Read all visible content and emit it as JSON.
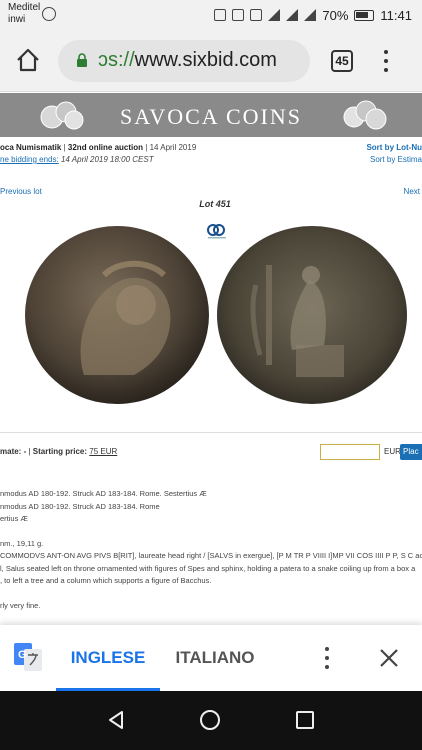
{
  "status_bar": {
    "carrier": "Meditel inwi",
    "battery": "70%",
    "time": "11:41"
  },
  "browser": {
    "url_prefix": "ɔs://",
    "url_domain": "www.sixbid.com",
    "tab_count": "45"
  },
  "site": {
    "title": "SAVOCA COINS"
  },
  "auction": {
    "house": "oca Numismatik",
    "sep1": "|",
    "auction_name": "32nd online auction",
    "sep2": "|",
    "date": "14 April 2019",
    "bidding_label": "ne bidding ends:",
    "bidding_end": "14 April 2019 18:00 CEST",
    "sort_lot": "Sort by Lot-Nu",
    "sort_estimate": "Sort by Estima"
  },
  "lot_nav": {
    "previous": "Previous lot",
    "next": "Next",
    "lot_title": "Lot 451"
  },
  "bid": {
    "estimate_label": "mate: -",
    "sep": "|",
    "starting_price_label": "Starting price:",
    "starting_price_value": "75 EUR",
    "currency": "EUR",
    "place_button": "Plac"
  },
  "description": {
    "line1": "nmodus AD 180-192. Struck AD 183-184. Rome. Sestertius Æ",
    "line2": "nmodus AD 180-192. Struck AD 183-184. Rome",
    "line3": "ertius Æ",
    "line4": "nm., 19,11 g.",
    "line5": "COMMODVS ANT-ON AVG PIVS B[RIT], laureate head right / [SALVS in exergue], [P M TR P VIIII I]MP VII COS IIII P P, S C acros",
    "line6": "l, Salus seated left on throne ornamented with figures of Spes and sphinx, holding a patera to a snake coiling up from a box a",
    "line7": ", to left a tree and a column which supports a figure of Bacchus.",
    "line8": "rly very fine."
  },
  "translate": {
    "tab_english": "INGLESE",
    "tab_italian": "ITALIANO"
  },
  "colors": {
    "accent_blue": "#1a73e8",
    "link_blue": "#1a6fb5",
    "header_gray": "#8a8a8a"
  }
}
